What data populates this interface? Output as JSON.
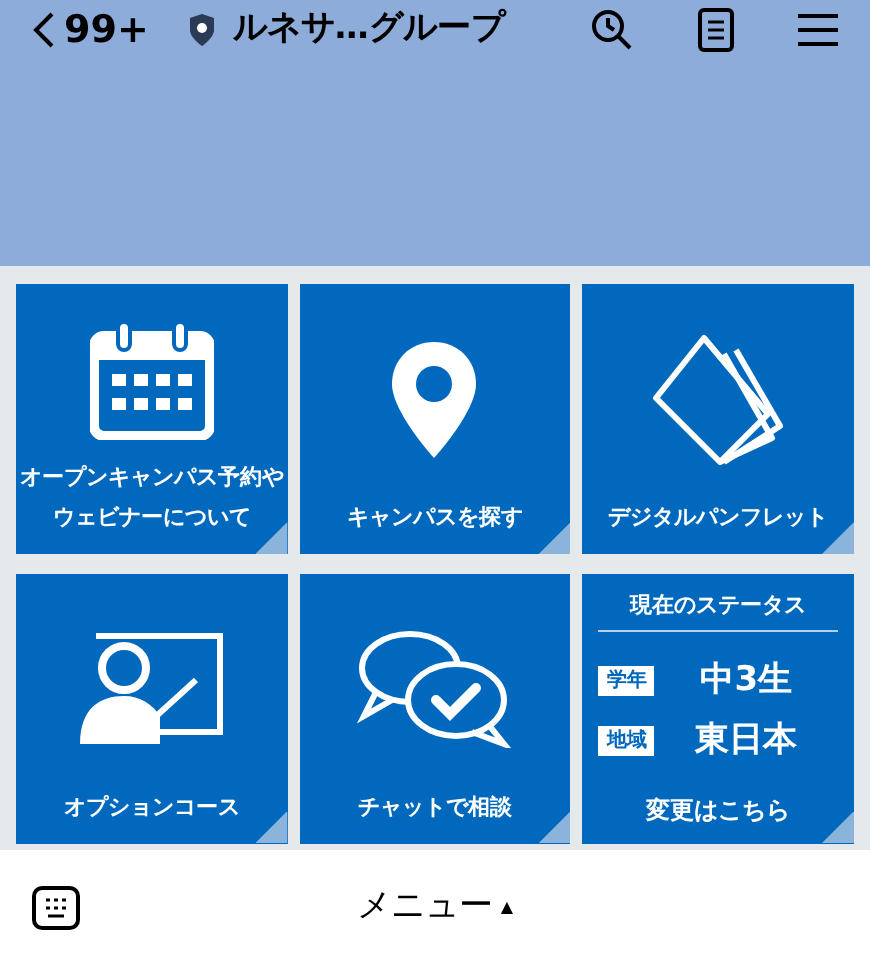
{
  "header": {
    "back_count": "99+",
    "title": "ルネサ…グループ"
  },
  "tiles": [
    {
      "kind": "calendar",
      "label": "オープンキャンパス予約や",
      "label_line_2": "ウェビナーについて"
    },
    {
      "kind": "pin",
      "label": "キャンパスを探す"
    },
    {
      "kind": "pamphlet",
      "label": "デジタルパンフレット"
    },
    {
      "kind": "teacher",
      "label": "オプションコース"
    },
    {
      "kind": "chat",
      "label": "チャットで相談"
    },
    {
      "kind": "status",
      "title": "現在のステータス",
      "rows": [
        {
          "tag": "学年",
          "value": "中3生"
        },
        {
          "tag": "地域",
          "value": "東日本"
        }
      ],
      "label": "変更はこちら"
    }
  ],
  "footer": {
    "menu_label": "メニュー",
    "menu_arrow": "▲"
  }
}
